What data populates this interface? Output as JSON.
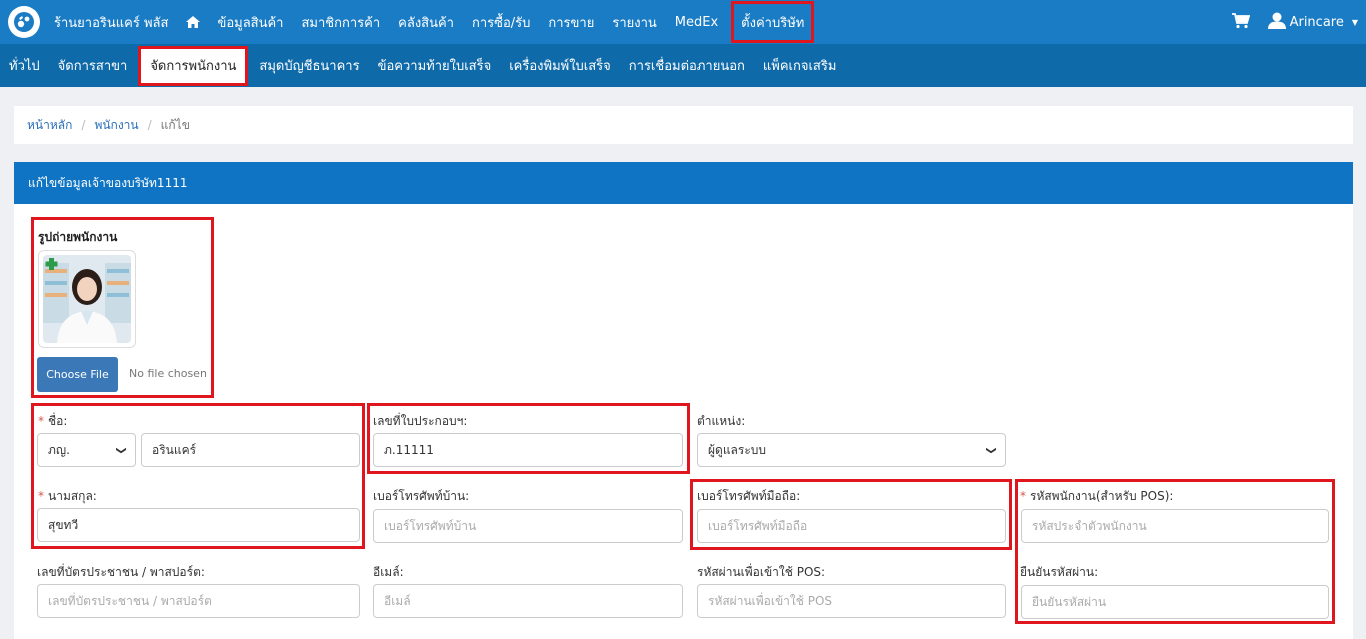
{
  "topbar": {
    "brand": "ร้านยาอรินแคร์ พลัส",
    "nav": [
      "ข้อมูลสินค้า",
      "สมาชิกการค้า",
      "คลังสินค้า",
      "การซื้อ/รับ",
      "การขาย",
      "รายงาน",
      "MedEx"
    ],
    "active": "ตั้งค่าบริษัท",
    "user": "Arincare"
  },
  "subnav": {
    "items": [
      "ทั่วไป",
      "จัดการสาขา",
      "จัดการพนักงาน",
      "สมุดบัญชีธนาคาร",
      "ข้อความท้ายใบเสร็จ",
      "เครื่องพิมพ์ใบเสร็จ",
      "การเชื่อมต่อภายนอก",
      "แพ็คเกจเสริม"
    ]
  },
  "breadcrumb": {
    "home": "หน้าหลัก",
    "employees": "พนักงาน",
    "current": "แก้ไข"
  },
  "panel": {
    "title": "แก้ไขข้อมูลเจ้าของบริษัท1111",
    "photo_label": "รูปถ่ายพนักงาน",
    "choose_file": "Choose File",
    "no_file": "No file chosen"
  },
  "form": {
    "first_name_label": "ชื่อ:",
    "prefix": "ภญ.",
    "first_name": "อรินแคร์",
    "license_label": "เลขที่ใบประกอบฯ:",
    "license": "ภ.11111",
    "position_label": "ตำแหน่ง:",
    "position": "ผู้ดูแลระบบ",
    "last_name_label": "นามสกุล:",
    "last_name": "สุขทวี",
    "home_phone_label": "เบอร์โทรศัพท์บ้าน:",
    "home_phone_ph": "เบอร์โทรศัพท์บ้าน",
    "mobile_label": "เบอร์โทรศัพท์มือถือ:",
    "mobile_ph": "เบอร์โทรศัพท์มือถือ",
    "pos_code_label": "รหัสพนักงาน(สำหรับ POS):",
    "pos_code_ph": "รหัสประจำตัวพนักงาน",
    "id_label": "เลขที่บัตรประชาชน / พาสปอร์ต:",
    "id_ph": "เลขที่บัตรประชาชน / พาสปอร์ต",
    "email_label": "อีเมล์:",
    "email_ph": "อีเมล์",
    "pos_pass_label": "รหัสผ่านเพื่อเข้าใช้ POS:",
    "pos_pass_ph": "รหัสผ่านเพื่อเข้าใช้ POS",
    "confirm_label": "ยืนยันรหัสผ่าน:",
    "confirm_ph": "ยืนยันรหัสผ่าน",
    "required_mark": "*"
  },
  "colors": {
    "topbar": "#1a7cc4",
    "subbar": "#0f6aa9",
    "panel_head": "#0f74c3",
    "highlight": "#e0161e"
  }
}
